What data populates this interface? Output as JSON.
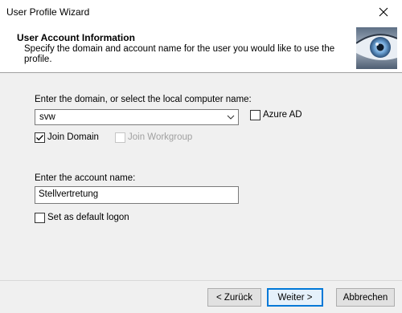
{
  "window": {
    "title": "User Profile Wizard",
    "close_glyph": "✕"
  },
  "header": {
    "title": "User Account Information",
    "subtitle": "Specify the domain and account name for the user you would like to use the profile.",
    "image_icon": "eye-icon"
  },
  "domain": {
    "label": "Enter the domain, or select the local computer name:",
    "value": "svw",
    "azure_ad_label": "Azure AD",
    "azure_ad_checked": false,
    "join_domain_label": "Join Domain",
    "join_domain_checked": true,
    "join_workgroup_label": "Join Workgroup",
    "join_workgroup_checked": false
  },
  "account": {
    "label": "Enter the account name:",
    "value": "Stellvertretung",
    "default_logon_label": "Set as default logon",
    "default_logon_checked": false
  },
  "buttons": {
    "back": "< Zurück",
    "next": "Weiter >",
    "cancel": "Abbrechen"
  },
  "colors": {
    "accent": "#0078d7",
    "dialog_bg": "#f0f0f0"
  }
}
